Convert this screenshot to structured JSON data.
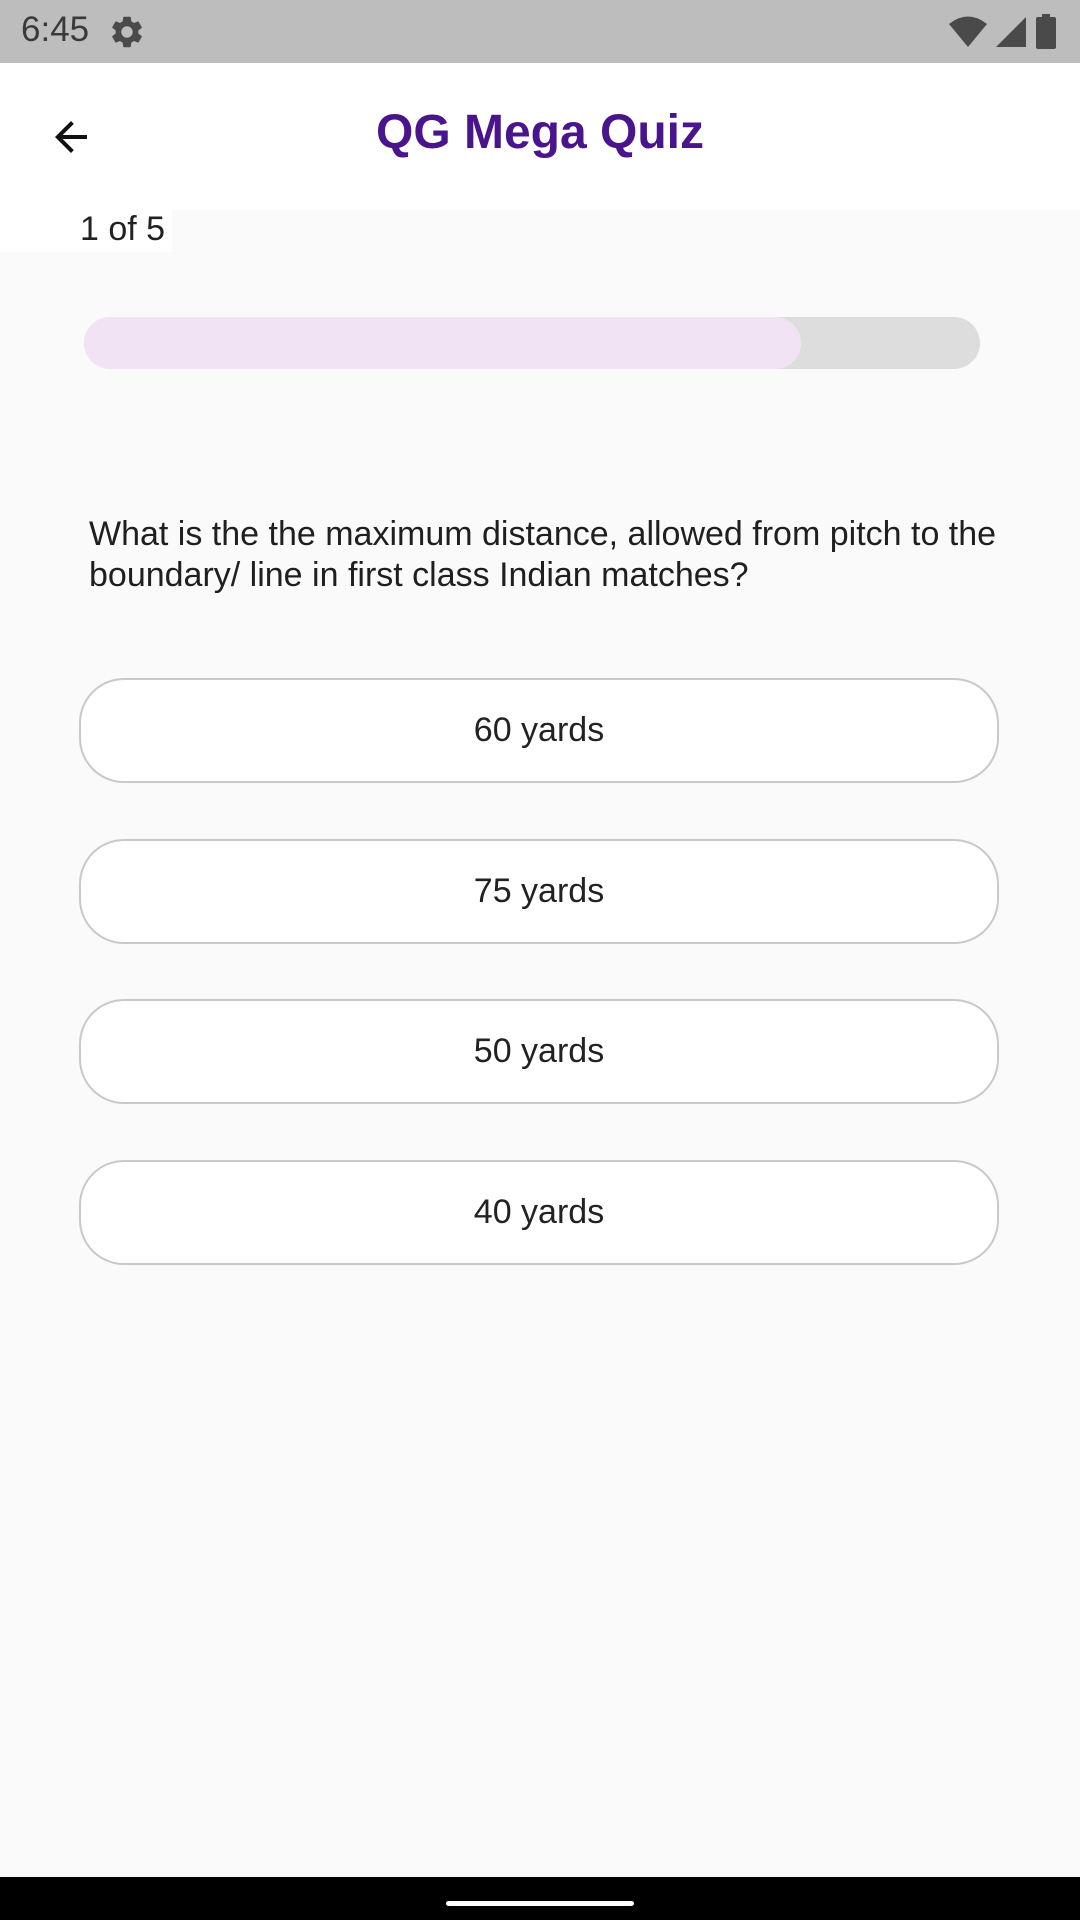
{
  "status_bar": {
    "time": "6:45",
    "icons": [
      "gear-icon",
      "wifi-icon",
      "cell-signal-icon",
      "battery-icon"
    ]
  },
  "app_bar": {
    "title": "QG Mega Quiz",
    "back_icon": "arrow-left-icon",
    "title_color": "#4a158c"
  },
  "quiz": {
    "counter": "1 of 5",
    "progress_fraction": 0.8,
    "question_lines": [
      "What is the the maximum distance, allowed from pitch to the",
      "boundary/ line in first class Indian matches?"
    ],
    "options": [
      "60 yards",
      "75 yards",
      "50 yards",
      "40 yards"
    ]
  },
  "colors": {
    "progress_fill": "#f1e3f4",
    "progress_track": "#dddddd",
    "background": "#fafafa"
  }
}
